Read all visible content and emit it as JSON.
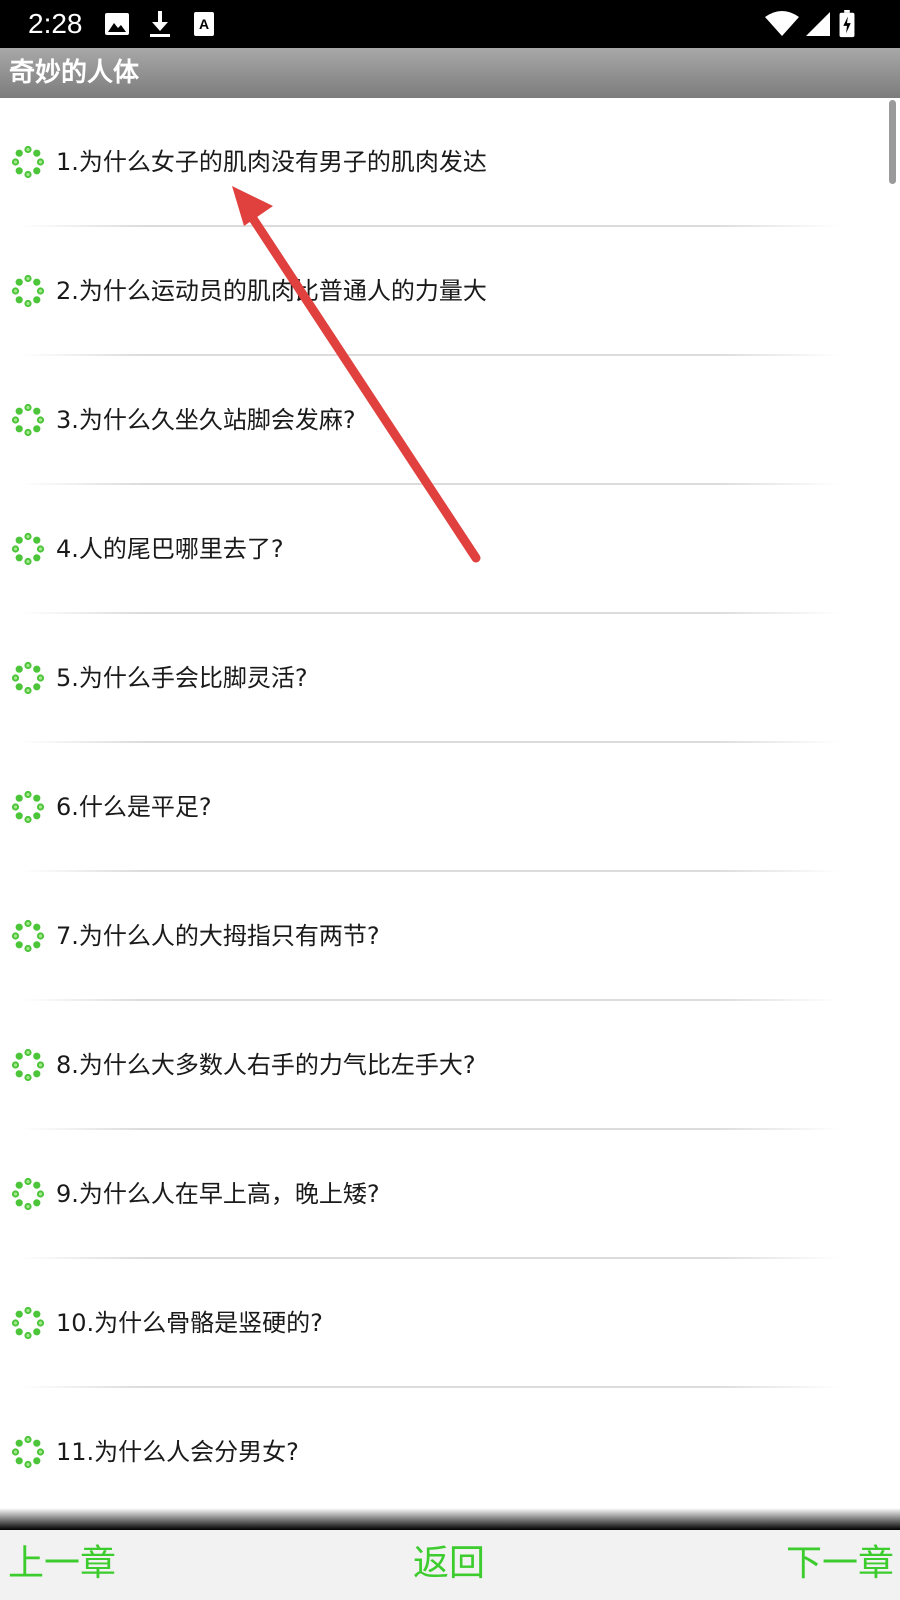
{
  "status_bar": {
    "time": "2:28",
    "icons": [
      "image-icon",
      "download-icon",
      "font-icon",
      "wifi-icon",
      "signal-icon",
      "battery-icon"
    ]
  },
  "app_title": "奇妙的人体",
  "items": [
    {
      "label": "1.为什么女子的肌肉没有男子的肌肉发达"
    },
    {
      "label": "2.为什么运动员的肌肉比普通人的力量大"
    },
    {
      "label": "3.为什么久坐久站脚会发麻?"
    },
    {
      "label": "4.人的尾巴哪里去了?"
    },
    {
      "label": "5.为什么手会比脚灵活?"
    },
    {
      "label": "6.什么是平足?"
    },
    {
      "label": "7.为什么人的大拇指只有两节?"
    },
    {
      "label": "8.为什么大多数人右手的力气比左手大?"
    },
    {
      "label": "9.为什么人在早上高，晚上矮?"
    },
    {
      "label": "10.为什么骨骼是竖硬的?"
    },
    {
      "label": "11.为什么人会分男女?"
    }
  ],
  "bottom_nav": {
    "prev": "上一章",
    "back": "返回",
    "next": "下一章"
  },
  "colors": {
    "accent": "#3dcc2e",
    "arrow": "#e0413e"
  }
}
